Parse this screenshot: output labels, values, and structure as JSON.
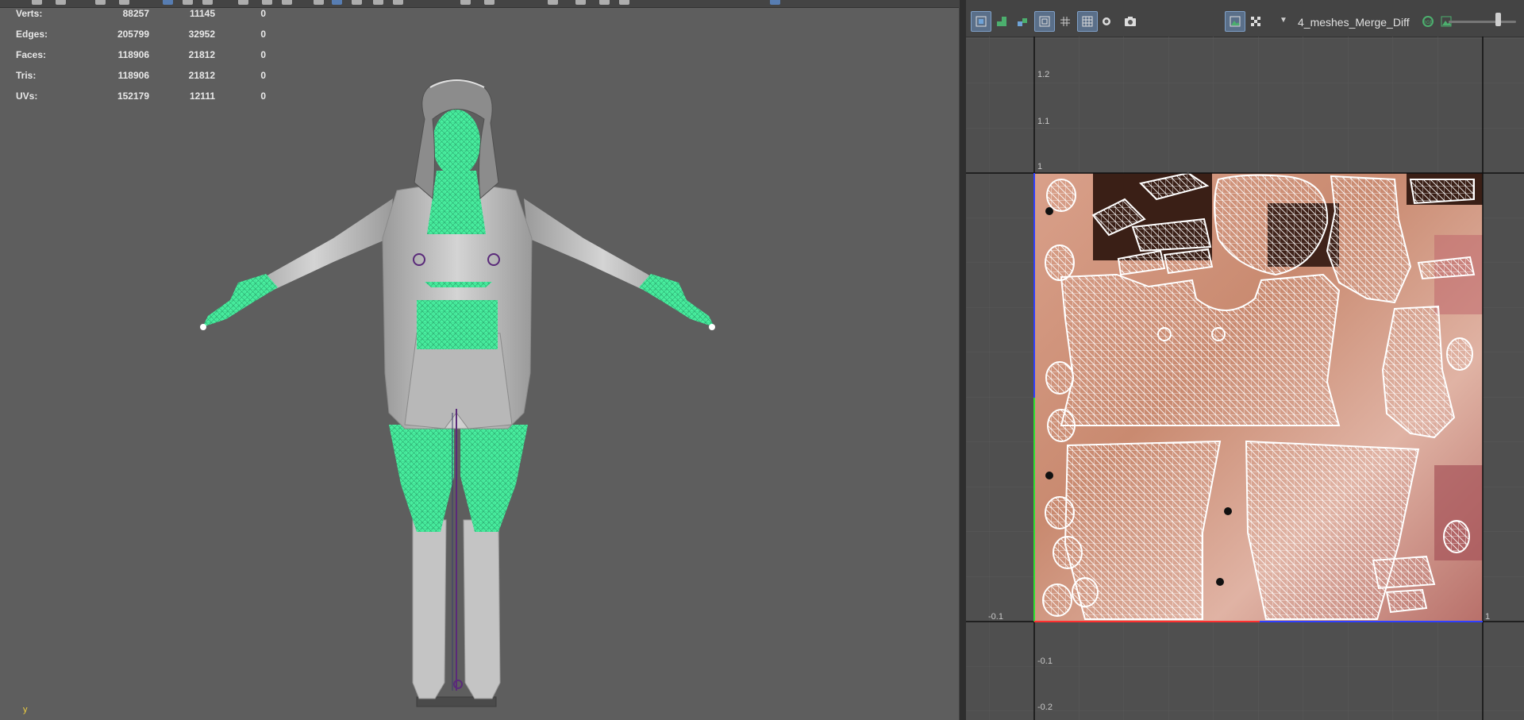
{
  "stats": {
    "rows": [
      {
        "label": "Verts:",
        "c1": "88257",
        "c2": "11145",
        "c3": "0"
      },
      {
        "label": "Edges:",
        "c1": "205799",
        "c2": "32952",
        "c3": "0"
      },
      {
        "label": "Faces:",
        "c1": "118906",
        "c2": "21812",
        "c3": "0"
      },
      {
        "label": "Tris:",
        "c1": "118906",
        "c2": "21812",
        "c3": "0"
      },
      {
        "label": "UVs:",
        "c1": "152179",
        "c2": "12111",
        "c3": "0"
      }
    ]
  },
  "viewport": {
    "axis_label": "y"
  },
  "uv_editor": {
    "texture_name": "4_meshes_Merge_Diff",
    "grid_labels": {
      "v_1_2": "1.2",
      "v_1_1": "1.1",
      "v_1": "1",
      "u_neg_0_1": "-0.1",
      "u_1": "1",
      "v_neg_0_1": "-0.1",
      "v_neg_0_2": "-0.2"
    }
  },
  "colors": {
    "viewport_bg": "#5e5e5e",
    "uv_bg": "#4f4f4f",
    "selection_green": "#49f0a0",
    "highlight_blue": "#5a87c5",
    "uv_border_blue": "#3040ff",
    "uv_red": "#ff3030",
    "uv_green": "#30e030"
  }
}
